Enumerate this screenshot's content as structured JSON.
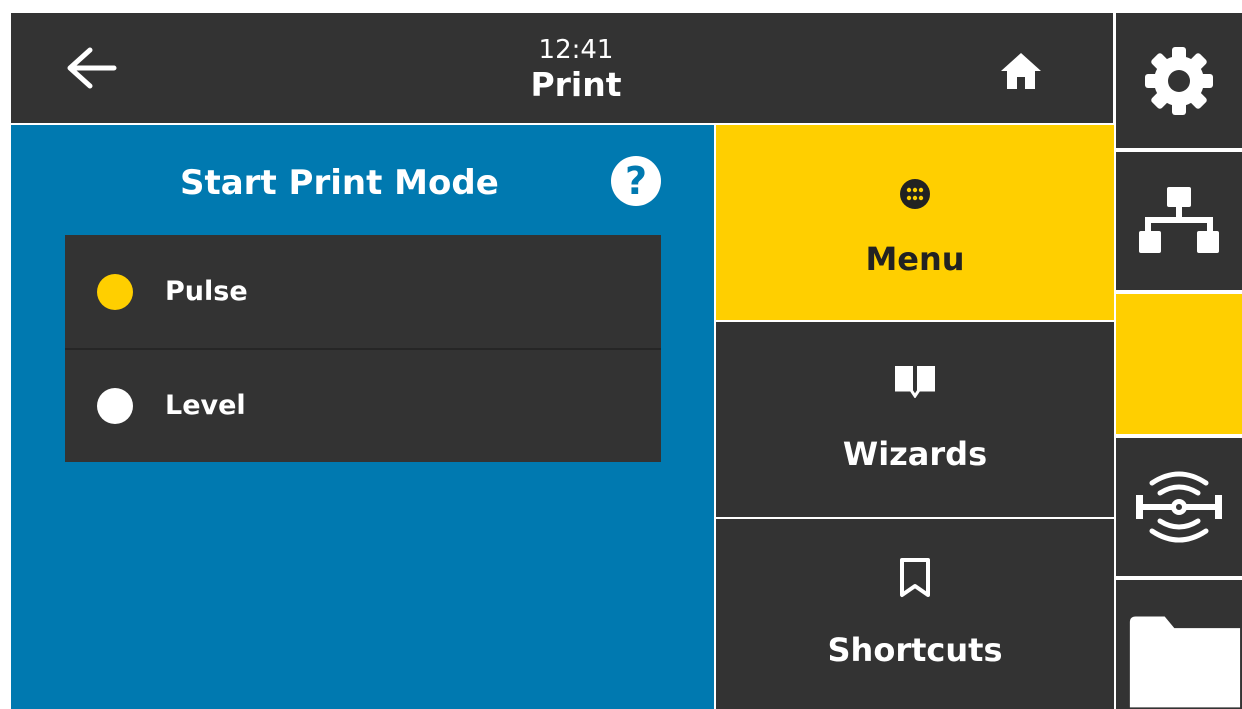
{
  "header": {
    "time": "12:41",
    "title": "Print",
    "back_icon": "arrow-left-icon",
    "home_icon": "home-icon"
  },
  "setting": {
    "title": "Start Print Mode",
    "help_label": "?",
    "options": [
      {
        "label": "Pulse",
        "selected": true
      },
      {
        "label": "Level",
        "selected": false
      }
    ]
  },
  "nav": {
    "menu": {
      "label": "Menu",
      "icon": "menu-grid-icon",
      "active": true
    },
    "wizards": {
      "label": "Wizards",
      "icon": "book-icon",
      "active": false
    },
    "shortcuts": {
      "label": "Shortcuts",
      "icon": "bookmark-icon",
      "active": false
    }
  },
  "side": [
    {
      "icon": "gear-icon"
    },
    {
      "icon": "network-icon"
    },
    {
      "icon": "print-selected-blank",
      "active": true
    },
    {
      "icon": "rfid-icon"
    },
    {
      "icon": "folder-icon"
    }
  ],
  "colors": {
    "accent": "#ffcf00",
    "panel": "#0079b0",
    "dark": "#333333",
    "text": "#ffffff"
  }
}
